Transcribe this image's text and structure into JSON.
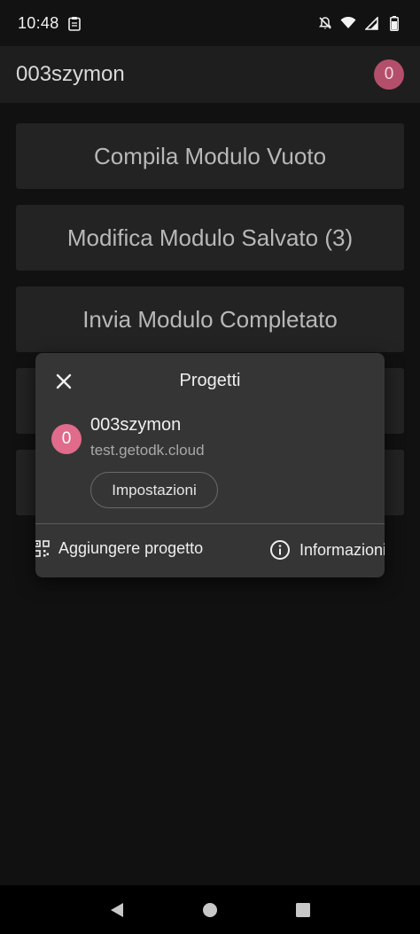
{
  "status_bar": {
    "time": "10:48",
    "left_icons": [
      "clipboard-icon"
    ],
    "right_icons": [
      "notifications-off-icon",
      "wifi-icon",
      "signal-icon",
      "battery-icon"
    ]
  },
  "app_bar": {
    "title": "003szymon",
    "avatar_letter": "0",
    "avatar_color": "#b44f6b"
  },
  "main_buttons": [
    {
      "label": "Compila Modulo Vuoto"
    },
    {
      "label": "Modifica Modulo Salvato (3)"
    },
    {
      "label": "Invia Modulo Completato"
    }
  ],
  "dialog": {
    "title": "Progetti",
    "project": {
      "avatar_letter": "0",
      "avatar_color": "#e06b8a",
      "name": "003szymon",
      "url": "test.getodk.cloud",
      "settings_label": "Impostazioni"
    },
    "actions": {
      "add_project": "Aggiungere progetto",
      "about": "Informazioni"
    }
  },
  "nav_bar": {
    "icons": [
      "back-icon",
      "home-icon",
      "recents-icon"
    ]
  }
}
